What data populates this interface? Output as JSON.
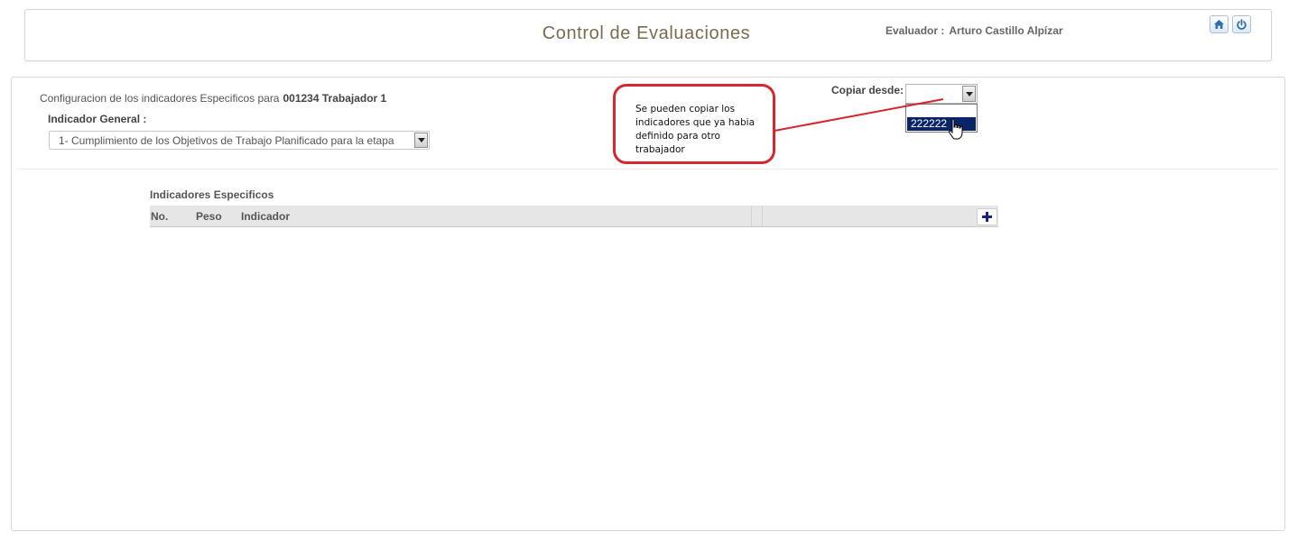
{
  "header": {
    "title": "Control de Evaluaciones",
    "evaluator_label": "Evaluador :",
    "evaluator_name": "Arturo Castillo Alpízar",
    "home_icon": "home-icon",
    "power_icon": "power-icon"
  },
  "config": {
    "prefix": "Configuracion de los indicadores Especificos para",
    "worker": "001234 Trabajador 1",
    "indicador_general_label": "Indicador General :",
    "indicador_general_value": "1- Cumplimiento de los Objetivos de Trabajo Planificado para la etapa"
  },
  "copiar": {
    "label": "Copiar desde:",
    "selected_value": "",
    "options": [
      "222222"
    ]
  },
  "callout": {
    "text": "Se pueden copiar los indicadores que ya habia definido para otro trabajador"
  },
  "specific": {
    "title": "Indicadores Especificos",
    "columns": [
      "No.",
      "Peso",
      "Indicador"
    ],
    "add_icon": "plus-icon"
  },
  "colors": {
    "title": "#7a6a4f",
    "callout_border": "#d6262f",
    "selection": "#0a246a",
    "add_icon": "#1a237e"
  }
}
